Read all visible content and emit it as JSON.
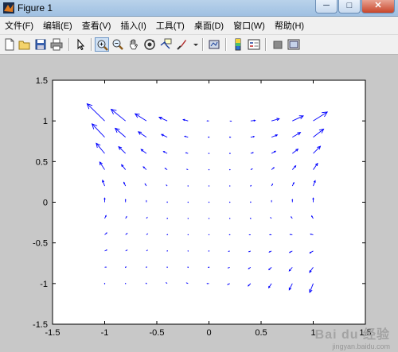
{
  "window": {
    "title": "Figure 1",
    "minimize": "─",
    "maximize": "□",
    "close": "✕"
  },
  "menu": [
    "文件(F)",
    "编辑(E)",
    "查看(V)",
    "插入(I)",
    "工具(T)",
    "桌面(D)",
    "窗口(W)",
    "帮助(H)"
  ],
  "toolbar": {
    "buttons": [
      "new-figure-icon",
      "open-file-icon",
      "save-icon",
      "print-icon",
      "edit-plot-arrow-icon",
      "zoom-in-icon",
      "zoom-out-icon",
      "pan-hand-icon",
      "rotate-3d-icon",
      "data-cursor-icon",
      "brush-icon",
      "link-plot-icon",
      "colorbar-icon",
      "legend-icon",
      "hide-plot-tools-icon",
      "show-plot-tools-icon"
    ],
    "pressed": "zoom-in-icon"
  },
  "chart_data": {
    "type": "quiver",
    "xlim": [
      -1.5,
      1.5
    ],
    "ylim": [
      -1.5,
      1.5
    ],
    "xticks": [
      "-1.5",
      "-1",
      "-0.5",
      "0",
      "0.5",
      "1",
      "1.5"
    ],
    "yticks": [
      "1.5",
      "1",
      "0.5",
      "0",
      "-0.5",
      "-1",
      "-1.5"
    ],
    "grid_x": [
      -1,
      -0.8,
      -0.6,
      -0.4,
      -0.2,
      0,
      0.2,
      0.4,
      0.6,
      0.8,
      1
    ],
    "grid_y": [
      -1,
      -0.8,
      -0.6,
      -0.4,
      -0.2,
      0,
      0.2,
      0.4,
      0.6,
      0.8,
      1
    ],
    "field": {
      "u": "x*y + 0.8*x*y^2 - 0.2*y^2",
      "v": "x^2*y + 0.6*x^2 - 0.6*x*y^2 + 0.3*x^2*y^3"
    },
    "grid": false,
    "color": "#0000ff"
  },
  "watermark": {
    "main": "Bai du 经验",
    "sub": "jingyan.baidu.com"
  }
}
